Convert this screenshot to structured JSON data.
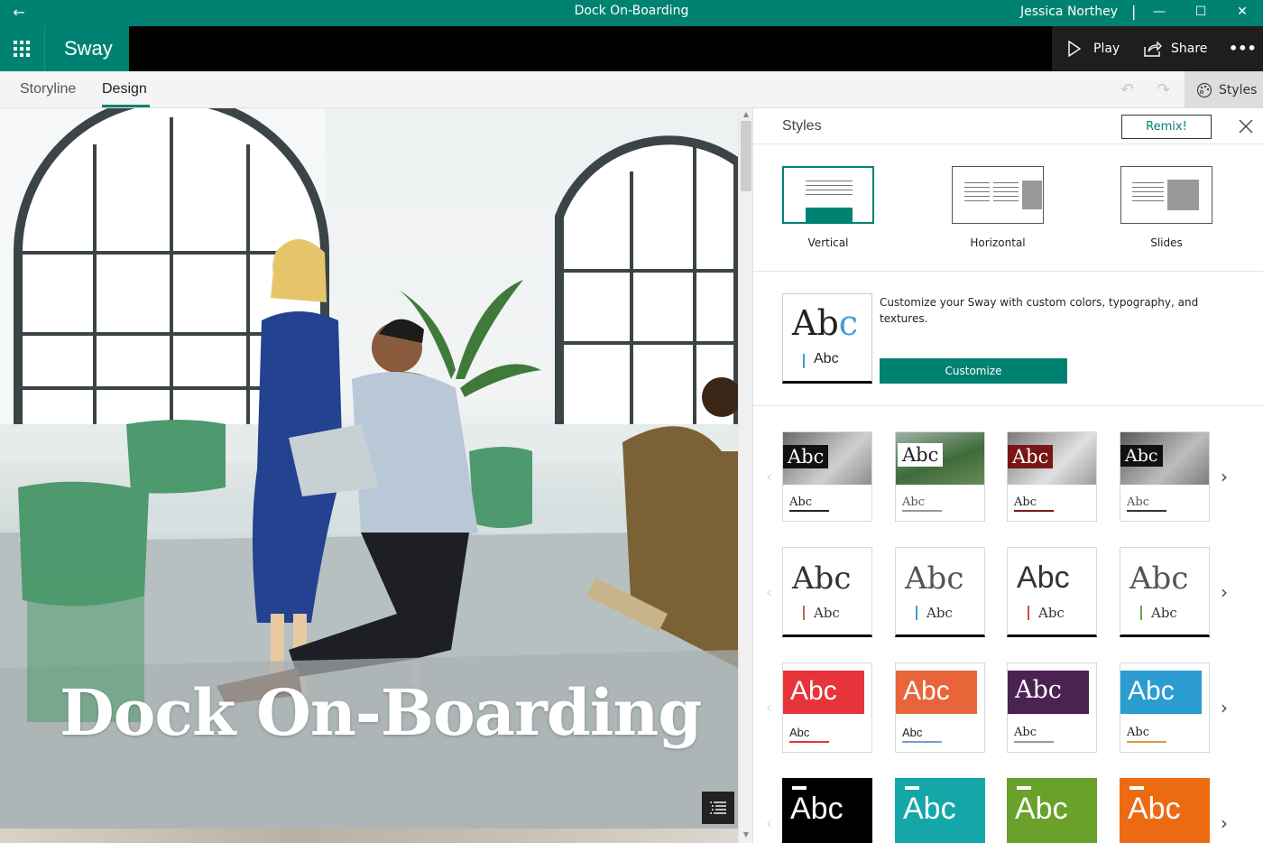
{
  "window": {
    "title": "Dock On-Boarding",
    "user": "Jessica Northey",
    "separator": "|"
  },
  "appbar": {
    "brand": "Sway",
    "play_label": "Play",
    "share_label": "Share",
    "more_label": "•••"
  },
  "cmdbar": {
    "tabs": [
      {
        "label": "Storyline"
      },
      {
        "label": "Design"
      }
    ],
    "styles_label": "Styles"
  },
  "canvas": {
    "title": "Dock On-Boarding"
  },
  "styles_pane": {
    "title": "Styles",
    "remix_label": "Remix!",
    "layouts": [
      {
        "label": "Vertical",
        "selected": true
      },
      {
        "label": "Horizontal",
        "selected": false
      },
      {
        "label": "Slides",
        "selected": false
      }
    ],
    "customize": {
      "preview_big": "Ab",
      "preview_accent": "c",
      "preview_small": "Abc",
      "description": "Customize your Sway with custom colors, typography, and textures.",
      "button_label": "Customize"
    },
    "style_sample": "Abc",
    "colors": {
      "accent": "#008272",
      "row1": [
        "#111111",
        "#ffffff",
        "#7a1515",
        "#111111"
      ],
      "row2_accent": [
        "#c0655a",
        "#3a9fd6",
        "#d4493e",
        "#6aa84f"
      ],
      "row3": [
        "#e8333a",
        "#e8653a",
        "#4a2350",
        "#2a9cd0"
      ],
      "row4": [
        "#000000",
        "#15a7a7",
        "#6aa12a",
        "#ec6b12"
      ]
    }
  }
}
